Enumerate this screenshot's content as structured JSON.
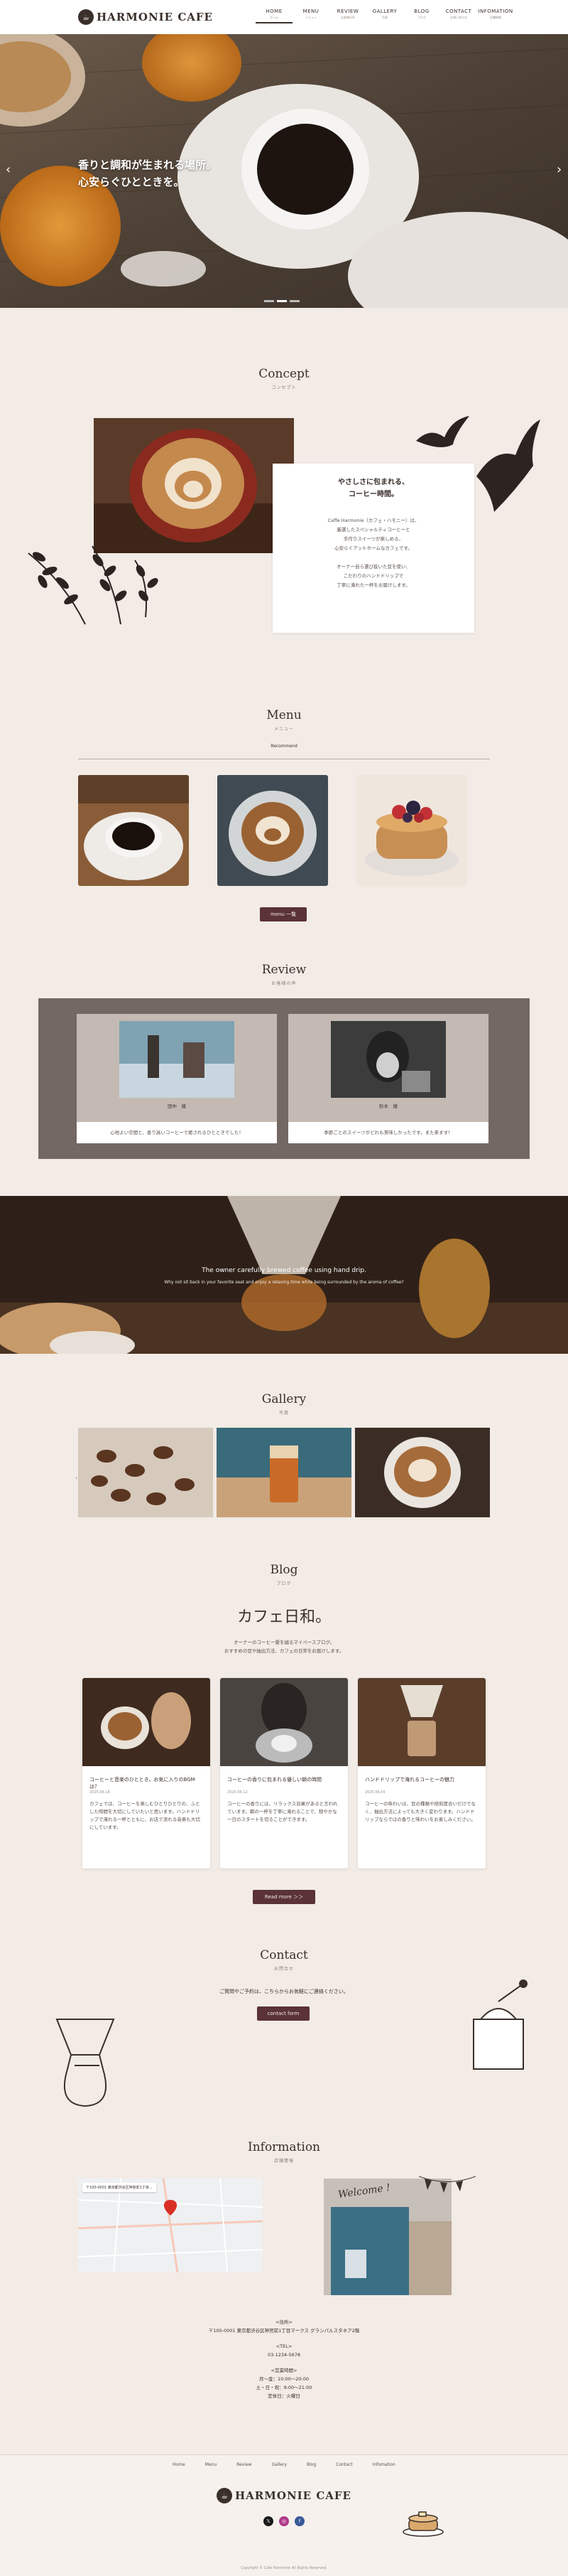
{
  "header": {
    "logo_text": "HARMONIE CAFE",
    "nav": [
      {
        "en": "HOME",
        "jp": "ホーム"
      },
      {
        "en": "MENU",
        "jp": "メニュー"
      },
      {
        "en": "REVIEW",
        "jp": "お客様の声"
      },
      {
        "en": "GALLERY",
        "jp": "写真"
      },
      {
        "en": "BLOG",
        "jp": "ブログ"
      },
      {
        "en": "CONTACT",
        "jp": "お問い合わせ"
      },
      {
        "en": "INFOMATION",
        "jp": "店舗情報"
      }
    ]
  },
  "hero": {
    "line1": "香りと調和が生まれる場所。",
    "line2": "心安らぐひとときを。",
    "prev": "‹",
    "next": "›"
  },
  "concept": {
    "title": "Concept",
    "subtitle": "コンセプト",
    "heading1": "やさしさに包まれる、",
    "heading2": "コーヒー時間。",
    "body": [
      "Caffe Harmonie（カフェ・ハモニー）は、",
      "厳選したスペシャルティコーヒーと",
      "手作りスイーツが楽しめる、",
      "心安らぐアットホームなカフェです。",
      "",
      "オーナー自ら選び抜いた豆を使い、",
      "こだわりのハンドドリップで",
      "丁寧に淹れた一杯をお届けします。"
    ]
  },
  "menu": {
    "title": "Menu",
    "subtitle": "メニュー",
    "tab": "Recommend",
    "button": "menu 一覧"
  },
  "review": {
    "title": "Review",
    "subtitle": "お客様の声",
    "items": [
      {
        "name": "田中　様",
        "text": "心地よい空間と、香り高いコーヒーで癒されるひとときでした！"
      },
      {
        "name": "鈴木　様",
        "text": "季節ごとのスイーツがどれも美味しかったです。また来ます！"
      }
    ]
  },
  "banner": {
    "line1": "The owner carefully brewed coffee using hand drip.",
    "line2": "Why not sit back in your favorite seat and enjoy a relaxing time while being surrounded by the aroma of coffee?"
  },
  "gallery": {
    "title": "Gallery",
    "subtitle": "写真"
  },
  "blog": {
    "title": "Blog",
    "subtitle": "ブログ",
    "logo": "カフェ日和。",
    "intro1": "オーナーのコーヒー愛を綴るマイペースブログ。",
    "intro2": "おすすめの豆や抽出方法、カフェの日常をお届けします。",
    "posts": [
      {
        "title": "コーヒーと音楽のひととき。お気に入りのBGMは？",
        "date": "2025.06.18",
        "excerpt": "カフェでは、コーヒーを楽しむひとりひとりの、ふとした時間を大切にしていたいと思います。ハンドドリップで淹れる一杯とともに、お店で流れる音楽も大切にしています。"
      },
      {
        "title": "コーヒーの香りに包まれる優しい朝の時間",
        "date": "2025.06.12",
        "excerpt": "コーヒーの香りには、リラックス効果があると言われています。朝の一杯を丁寧に淹れることで、穏やかな一日のスタートを切ることができます。"
      },
      {
        "title": "ハンドドリップで淹れるコーヒーの魅力",
        "date": "2025.06.05",
        "excerpt": "コーヒーの味わいは、豆の種類や焙煎度合いだけでなく、抽出方法によっても大きく変わります。ハンドドリップならではの香りと味わいをお楽しみください。"
      }
    ],
    "button": "Read more ＞＞"
  },
  "contact": {
    "title": "Contact",
    "subtitle": "お問合せ",
    "text": "ご質問やご予約は、こちらからお気軽にご連絡ください。",
    "button": "contact form"
  },
  "info": {
    "title": "Information",
    "subtitle": "店舗情報",
    "map_label": "〒100-0001 東京都渋谷区神宮前1丁目...",
    "welcome": "Welcome !",
    "address_title": "<住所>",
    "address": "〒100-0001 東京都渋谷区神宮前1丁目マークス グランパルスタネア2階",
    "tel_title": "<TEL>",
    "tel": "03-1234-5678",
    "hours_title": "<営業時間>",
    "hours1": "月〜金：10:00〜20:00",
    "hours2": "土・日・祝：9:00〜21:00",
    "holiday": "定休日：火曜日"
  },
  "footer": {
    "links": [
      "Home",
      "Menu",
      "Review",
      "Gallery",
      "Blog",
      "Contact",
      "Infomation"
    ],
    "logo_text": "HARMONIE CAFE",
    "copyright": "Copyright © Cafe Harmonie All Rights Reserved."
  }
}
